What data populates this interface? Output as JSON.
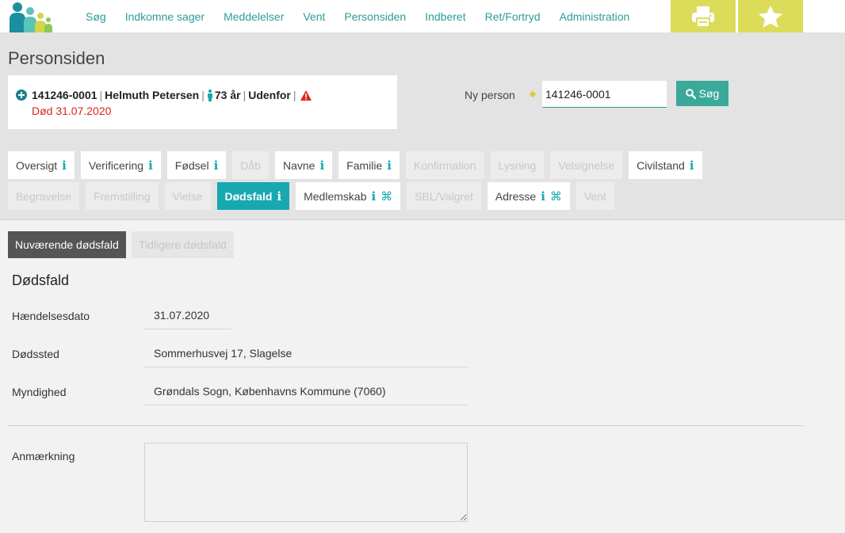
{
  "nav": {
    "items": [
      "Søg",
      "Indkomne sager",
      "Meddelelser",
      "Vent",
      "Personsiden",
      "Indberet",
      "Ret/Fortryd",
      "Administration"
    ]
  },
  "toolbar": {
    "print_icon": "printer-icon",
    "favorite_icon": "star-icon"
  },
  "page": {
    "title": "Personsiden"
  },
  "person": {
    "cpr": "141246-0001",
    "name": "Helmuth Petersen",
    "age": "73 år",
    "status": "Udenfor",
    "death_text": "Død 31.07.2020"
  },
  "search": {
    "label": "Ny person",
    "value": "141246-0001",
    "button_label": "Søg"
  },
  "tabs_row1": [
    {
      "label": "Oversigt",
      "info": true,
      "disabled": false
    },
    {
      "label": "Verificering",
      "info": true,
      "disabled": false
    },
    {
      "label": "Fødsel",
      "info": true,
      "disabled": false
    },
    {
      "label": "Dåb",
      "info": false,
      "disabled": true
    },
    {
      "label": "Navne",
      "info": true,
      "disabled": false
    },
    {
      "label": "Familie",
      "info": true,
      "disabled": false
    },
    {
      "label": "Konfirmation",
      "info": false,
      "disabled": true
    },
    {
      "label": "Lysning",
      "info": false,
      "disabled": true
    },
    {
      "label": "Velsignelse",
      "info": false,
      "disabled": true
    },
    {
      "label": "Civilstand",
      "info": true,
      "disabled": false
    }
  ],
  "tabs_row2": [
    {
      "label": "Begravelse",
      "info": false,
      "disabled": true
    },
    {
      "label": "Fremstilling",
      "info": false,
      "disabled": true
    },
    {
      "label": "Vielse",
      "info": false,
      "disabled": true
    },
    {
      "label": "Dødsfald",
      "info": true,
      "disabled": false,
      "active": true
    },
    {
      "label": "Medlemskab",
      "info": true,
      "cmd": true,
      "disabled": false
    },
    {
      "label": "SBL/Valgret",
      "info": false,
      "disabled": true
    },
    {
      "label": "Adresse",
      "info": true,
      "cmd": true,
      "disabled": false
    },
    {
      "label": "Vent",
      "info": false,
      "disabled": true
    }
  ],
  "subtabs": {
    "current": "Nuværende dødsfald",
    "previous": "Tidligere dødsfald"
  },
  "section": {
    "title": "Dødsfald"
  },
  "fields": {
    "event_date_label": "Hændelsesdato",
    "event_date_value": "31.07.2020",
    "place_label": "Dødssted",
    "place_value": "Sommerhusvej 17, Slagelse",
    "authority_label": "Myndighed",
    "authority_value": "Grøndals Sogn, Københavns Kommune (7060)",
    "remark_label": "Anmærkning",
    "remark_value": ""
  },
  "colors": {
    "accent": "#17a8b0",
    "nav_link": "#2e9b9b",
    "toolbar_yellow": "#dcdc5a",
    "death_red": "#d9261c",
    "search_button": "#3aa99a"
  }
}
